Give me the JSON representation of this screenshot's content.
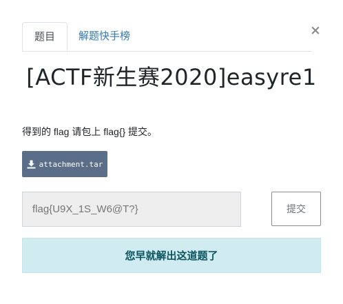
{
  "modal": {
    "close_label": "×"
  },
  "tabs": [
    {
      "label": "题目",
      "active": true
    },
    {
      "label": "解题快手榜",
      "active": false
    }
  ],
  "challenge": {
    "title": "[ACTF新生赛2020]easyre1",
    "description": "得到的 flag 请包上 flag{} 提交。",
    "attachment_label": "attachment.tar",
    "attachment_icon": "download-icon"
  },
  "submission": {
    "flag_placeholder": "flag{U9X_1S_W6@T?}",
    "flag_value": "",
    "submit_label": "提交"
  },
  "status": {
    "solved_message": "您早就解出这道题了"
  },
  "colors": {
    "attachment_button": "#5a6e8a",
    "tab_link": "#337ab7",
    "alert_bg": "#d1ecf1",
    "alert_text": "#0c5460"
  }
}
